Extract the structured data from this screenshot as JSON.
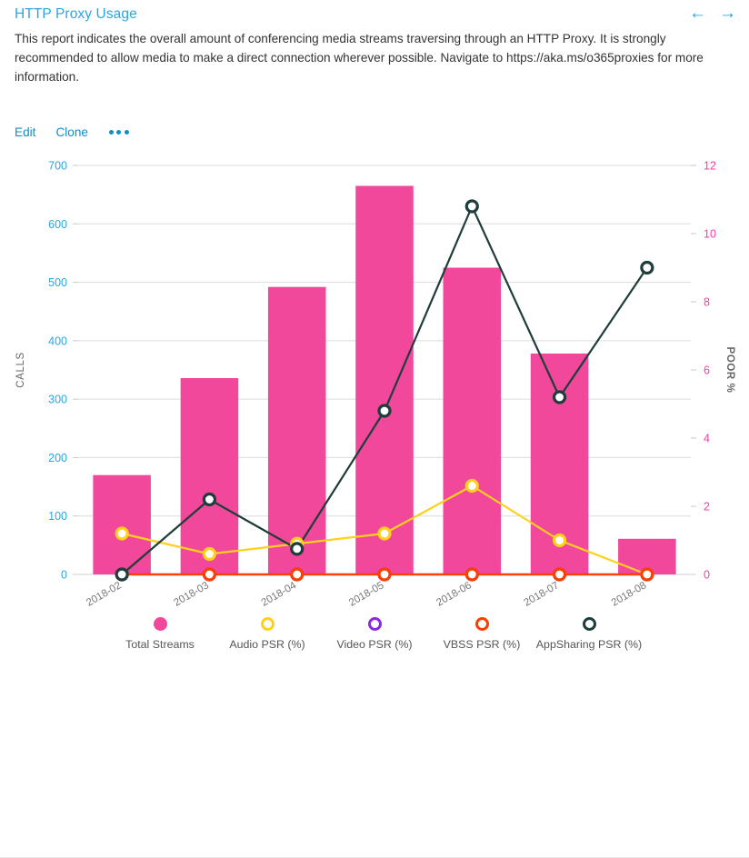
{
  "header": {
    "title": "HTTP Proxy Usage",
    "description": "This report indicates the overall amount of conferencing media streams traversing through an HTTP Proxy. It is strongly recommended to allow media to make a direct connection wherever possible. Navigate to https://aka.ms/o365proxies for more information.",
    "nav": {
      "back_icon": "←",
      "forward_icon": "→"
    }
  },
  "actions": {
    "edit_label": "Edit",
    "clone_label": "Clone",
    "more_label": "•••"
  },
  "chart_data": {
    "type": "bar",
    "title": "",
    "categories": [
      "2018-02",
      "2018-03",
      "2018-04",
      "2018-05",
      "2018-06",
      "2018-07",
      "2018-08"
    ],
    "xlabel": "",
    "ylabel": "CALLS",
    "y2label": "POOR %",
    "ylim": [
      0,
      700
    ],
    "y2lim": [
      0,
      12
    ],
    "yticks": [
      0,
      100,
      200,
      300,
      400,
      500,
      600,
      700
    ],
    "y2ticks": [
      0,
      2,
      4,
      6,
      8,
      10,
      12
    ],
    "grid": true,
    "legend_position": "bottom",
    "axis_left_color": "#2aa6e0",
    "axis_right_color": "#f43fa5",
    "series": [
      {
        "name": "Total Streams",
        "type": "bar",
        "axis": "left",
        "color": "#f2489b",
        "marker": "filled-circle",
        "values": [
          170,
          336,
          492,
          665,
          525,
          378,
          61
        ]
      },
      {
        "name": "Audio PSR (%)",
        "type": "line",
        "axis": "right",
        "color": "#ffd11a",
        "marker": "ring",
        "values": [
          1.2,
          0.6,
          0.9,
          1.2,
          2.6,
          1.0,
          0.0
        ]
      },
      {
        "name": "Video PSR (%)",
        "type": "line",
        "axis": "right",
        "color": "#8a2be2",
        "marker": "ring",
        "values": [
          0.0,
          0.0,
          0.0,
          0.0,
          0.0,
          0.0,
          0.0
        ]
      },
      {
        "name": "VBSS PSR (%)",
        "type": "line",
        "axis": "right",
        "color": "#fa4000",
        "marker": "ring",
        "values": [
          0.0,
          0.0,
          0.0,
          0.0,
          0.0,
          0.0,
          0.0
        ]
      },
      {
        "name": "AppSharing PSR (%)",
        "type": "line",
        "axis": "right",
        "color": "#1f3d3a",
        "marker": "ring",
        "values": [
          0.0,
          2.2,
          0.75,
          4.8,
          10.8,
          5.2,
          9.0
        ]
      }
    ]
  }
}
